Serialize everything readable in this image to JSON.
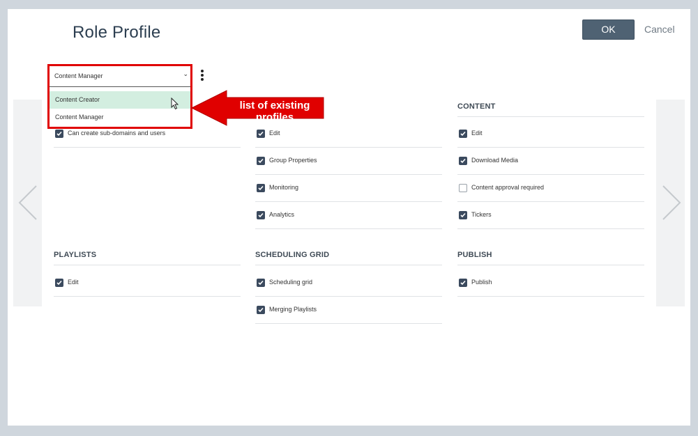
{
  "dialog": {
    "title": "Role Profile",
    "ok_label": "OK",
    "cancel_label": "Cancel"
  },
  "profile_select": {
    "current": "Content Manager",
    "options": [
      "Content Creator",
      "Content Manager"
    ],
    "highlighted": "Content Creator"
  },
  "annotation": {
    "text": "list of existing profiles",
    "color": "#e00000"
  },
  "sections": {
    "domains": {
      "heading": "",
      "items": [
        {
          "label": "Can create sub-domains and users",
          "checked": true
        }
      ]
    },
    "group": {
      "heading": "",
      "items": [
        {
          "label": "Edit",
          "checked": true
        },
        {
          "label": "Group Properties",
          "checked": true
        },
        {
          "label": "Monitoring",
          "checked": true
        },
        {
          "label": "Analytics",
          "checked": true
        }
      ]
    },
    "content": {
      "heading": "CONTENT",
      "items": [
        {
          "label": "Edit",
          "checked": true
        },
        {
          "label": "Download Media",
          "checked": true
        },
        {
          "label": "Content approval required",
          "checked": false
        },
        {
          "label": "Tickers",
          "checked": true
        }
      ]
    },
    "playlists": {
      "heading": "PLAYLISTS",
      "items": [
        {
          "label": "Edit",
          "checked": true
        }
      ]
    },
    "scheduling_grid": {
      "heading": "SCHEDULING GRID",
      "items": [
        {
          "label": "Scheduling grid",
          "checked": true
        },
        {
          "label": "Merging Playlists",
          "checked": true
        }
      ]
    },
    "publish": {
      "heading": "PUBLISH",
      "items": [
        {
          "label": "Publish",
          "checked": true
        }
      ]
    }
  },
  "icons": {
    "prev": "chevron-left-icon",
    "next": "chevron-right-icon",
    "more": "more-vertical-icon",
    "cursor": "mouse-pointer-icon"
  },
  "colors": {
    "accent": "#4f6273",
    "checkbox": "#3b4a5e",
    "highlight": "#d3eee0"
  }
}
